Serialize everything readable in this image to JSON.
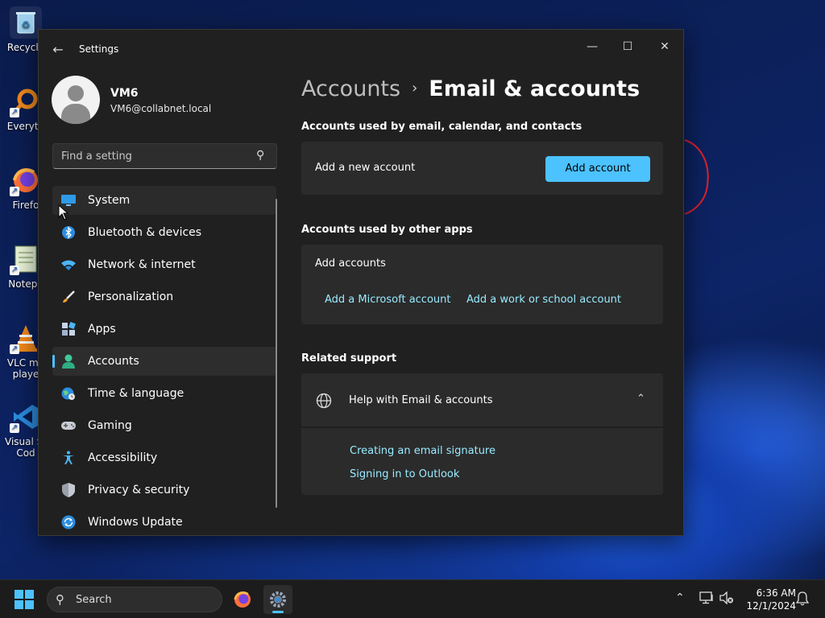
{
  "desktop": {
    "icons": [
      {
        "label": "Recycle",
        "icon": "recycle-bin-icon"
      },
      {
        "label": "Everyth",
        "icon": "everything-search-icon"
      },
      {
        "label": "Firefo",
        "icon": "firefox-icon"
      },
      {
        "label": "Notepa",
        "icon": "notepad-icon"
      },
      {
        "label": "VLC me\nplaye",
        "icon": "vlc-icon"
      },
      {
        "label": "Visual St\nCod",
        "icon": "vscode-icon"
      }
    ]
  },
  "window": {
    "title": "Settings",
    "controls": {
      "minimize": "—",
      "maximize": "☐",
      "close": "✕"
    }
  },
  "profile": {
    "name": "VM6",
    "email": "VM6@collabnet.local"
  },
  "search": {
    "placeholder": "Find a setting"
  },
  "nav": {
    "items": [
      {
        "label": "System",
        "icon": "system-display-icon"
      },
      {
        "label": "Bluetooth & devices",
        "icon": "bluetooth-icon"
      },
      {
        "label": "Network & internet",
        "icon": "wifi-icon"
      },
      {
        "label": "Personalization",
        "icon": "brush-icon"
      },
      {
        "label": "Apps",
        "icon": "apps-icon"
      },
      {
        "label": "Accounts",
        "icon": "accounts-icon",
        "selected": true
      },
      {
        "label": "Time & language",
        "icon": "globe-clock-icon"
      },
      {
        "label": "Gaming",
        "icon": "gamepad-icon"
      },
      {
        "label": "Accessibility",
        "icon": "accessibility-icon"
      },
      {
        "label": "Privacy & security",
        "icon": "shield-icon"
      },
      {
        "label": "Windows Update",
        "icon": "update-icon"
      }
    ]
  },
  "breadcrumb": {
    "parent": "Accounts",
    "separator": "›",
    "current": "Email & accounts"
  },
  "sections": {
    "email": {
      "title": "Accounts used by email, calendar, and contacts",
      "row_label": "Add a new account",
      "button": "Add account"
    },
    "other_apps": {
      "title": "Accounts used by other apps",
      "row_label": "Add accounts",
      "link_microsoft": "Add a Microsoft account",
      "link_work": "Add a work or school account"
    },
    "support": {
      "title": "Related support",
      "help_title": "Help with Email & accounts",
      "links": [
        "Creating an email signature",
        "Signing in to Outlook"
      ]
    }
  },
  "taskbar": {
    "search_label": "Search",
    "time": "6:36 AM",
    "date": "12/1/2024"
  },
  "colors": {
    "accent": "#4cc2ff",
    "link": "#99ebff",
    "window_bg": "#202020",
    "card_bg": "#2b2b2b"
  }
}
